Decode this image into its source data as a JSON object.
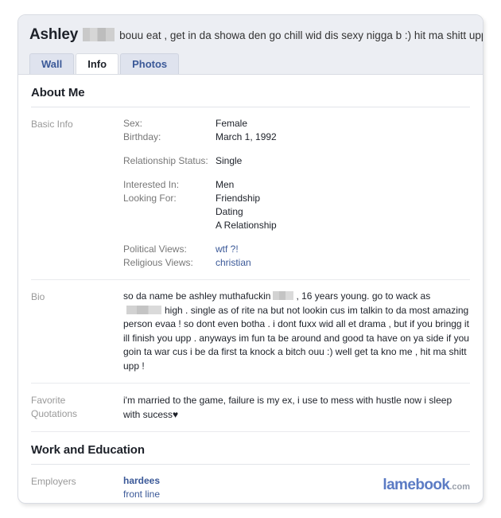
{
  "profile": {
    "name": "Ashley",
    "name_redacted": true,
    "status_text": "bouu eat , get in da showa den go chill wid dis sexy nigga b :) hit ma shitt uppp !",
    "tabs": [
      {
        "label": "Wall",
        "active": false
      },
      {
        "label": "Info",
        "active": true
      },
      {
        "label": "Photos",
        "active": false
      }
    ]
  },
  "sections": {
    "about_me": {
      "heading": "About Me",
      "basic_info": {
        "label": "Basic Info",
        "fields": [
          {
            "key": "Sex:",
            "value": "Female"
          },
          {
            "key": "Birthday:",
            "value": "March 1, 1992"
          },
          {
            "key": "Relationship Status:",
            "value": "Single"
          },
          {
            "key": "Interested In:",
            "value": "Men"
          },
          {
            "key": "Looking For:",
            "value": "Friendship"
          },
          {
            "key": "",
            "value": "Dating"
          },
          {
            "key": "",
            "value": "A Relationship"
          },
          {
            "key": "Political Views:",
            "value": "wtf ?!",
            "link": true
          },
          {
            "key": "Religious Views:",
            "value": "christian",
            "link": true
          }
        ],
        "sex_key": "Sex:",
        "sex_value": "Female",
        "birthday_key": "Birthday:",
        "birthday_value": "March 1, 1992",
        "relationship_key": "Relationship Status:",
        "relationship_value": "Single",
        "interested_key": "Interested In:",
        "interested_value": "Men",
        "looking_key": "Looking For:",
        "looking_value_1": "Friendship",
        "looking_value_2": "Dating",
        "looking_value_3": "A Relationship",
        "political_key": "Political Views:",
        "political_value": "wtf ?!",
        "religious_key": "Religious Views:",
        "religious_value": "christian"
      },
      "bio": {
        "label": "Bio",
        "part1": "so da name be ashley muthafuckin",
        "part2": ", 16 years young. go to wack as",
        "part3": "high . single as of rite na but not lookin cus im talkin to da most amazing person evaa ! so dont even botha . i dont fuxx wid all et drama , but if you bringg it ill finish you upp . anyways im fun ta be around and good ta have on ya side if you goin ta war cus i be da first ta knock a bitch ouu :) well get ta kno me , hit ma shitt upp !"
      },
      "quotations": {
        "label_line1": "Favorite",
        "label_line2": "Quotations",
        "text": "i'm married to the game, failure is my ex, i use to mess with hustle now i sleep with sucess",
        "heart": "♥"
      }
    },
    "work_education": {
      "heading": "Work and Education",
      "employers": {
        "label": "Employers",
        "name": "hardees",
        "role": "front line"
      }
    }
  },
  "watermark": {
    "main": "lamebook",
    "tld": ".com"
  },
  "colors": {
    "link_blue": "#3b5998",
    "watermark_blue": "#5b7bc4",
    "header_bg": "#eceef3",
    "tab_bg": "#dfe3ee",
    "label_gray": "#999999"
  }
}
